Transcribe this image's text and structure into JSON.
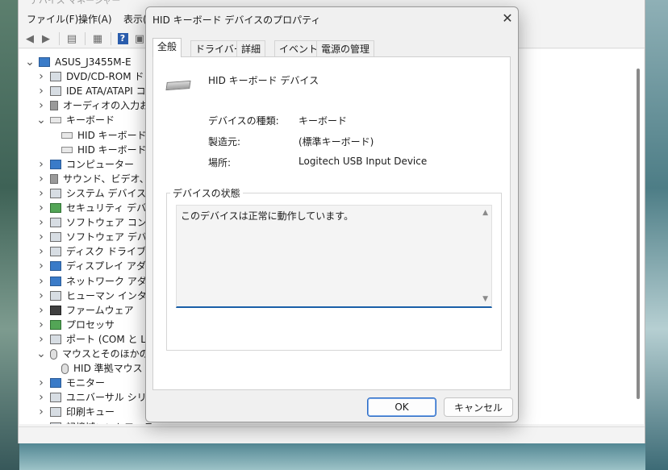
{
  "main_window": {
    "title": "デバイス マネージャー",
    "menu": [
      "ファイル(F)",
      "操作(A)",
      "表示("
    ],
    "tree": [
      {
        "label": "ASUS_J3455M-E",
        "level": 0,
        "expander": "v",
        "icon": "computer-icon"
      },
      {
        "label": "DVD/CD-ROM ドラ",
        "level": 1,
        "expander": ">",
        "icon": "dvd-drive-icon"
      },
      {
        "label": "IDE ATA/ATAPI コン",
        "level": 1,
        "expander": ">",
        "icon": "ide-controller-icon"
      },
      {
        "label": "オーディオの入力およ",
        "level": 1,
        "expander": ">",
        "icon": "audio-input-icon"
      },
      {
        "label": "キーボード",
        "level": 1,
        "expander": "v",
        "icon": "keyboard-icon"
      },
      {
        "label": "HID キーボード デ",
        "level": 2,
        "expander": "",
        "icon": "keyboard-icon"
      },
      {
        "label": "HID キーボード デ",
        "level": 2,
        "expander": "",
        "icon": "keyboard-icon"
      },
      {
        "label": "コンピューター",
        "level": 1,
        "expander": ">",
        "icon": "monitor-icon"
      },
      {
        "label": "サウンド、ビデオ、およ",
        "level": 1,
        "expander": ">",
        "icon": "speaker-icon"
      },
      {
        "label": "システム デバイス",
        "level": 1,
        "expander": ">",
        "icon": "system-device-icon"
      },
      {
        "label": "セキュリティ デバイス",
        "level": 1,
        "expander": ">",
        "icon": "security-device-icon"
      },
      {
        "label": "ソフトウェア コンポーネ",
        "level": 1,
        "expander": ">",
        "icon": "software-component-icon"
      },
      {
        "label": "ソフトウェア デバイス",
        "level": 1,
        "expander": ">",
        "icon": "software-device-icon"
      },
      {
        "label": "ディスク ドライブ",
        "level": 1,
        "expander": ">",
        "icon": "disk-drive-icon"
      },
      {
        "label": "ディスプレイ アダプター",
        "level": 1,
        "expander": ">",
        "icon": "display-adapter-icon"
      },
      {
        "label": "ネットワーク アダプター",
        "level": 1,
        "expander": ">",
        "icon": "network-adapter-icon"
      },
      {
        "label": "ヒューマン インターフェ",
        "level": 1,
        "expander": ">",
        "icon": "hid-icon"
      },
      {
        "label": "ファームウェア",
        "level": 1,
        "expander": ">",
        "icon": "firmware-icon"
      },
      {
        "label": "プロセッサ",
        "level": 1,
        "expander": ">",
        "icon": "processor-icon"
      },
      {
        "label": "ポート (COM と LPT",
        "level": 1,
        "expander": ">",
        "icon": "port-icon"
      },
      {
        "label": "マウスとそのほかのポ",
        "level": 1,
        "expander": "v",
        "icon": "mouse-icon"
      },
      {
        "label": "HID 準拠マウス",
        "level": 2,
        "expander": "",
        "icon": "mouse-icon"
      },
      {
        "label": "モニター",
        "level": 1,
        "expander": ">",
        "icon": "monitor-icon"
      },
      {
        "label": "ユニバーサル シリアル",
        "level": 1,
        "expander": ">",
        "icon": "usb-icon"
      },
      {
        "label": "印刷キュー",
        "level": 1,
        "expander": ">",
        "icon": "printer-icon"
      },
      {
        "label": "記憶域コントローラー",
        "level": 1,
        "expander": ">",
        "icon": "storage-controller-icon"
      }
    ]
  },
  "dialog": {
    "title": "HID キーボード デバイスのプロパティ",
    "close_glyph": "✕",
    "tabs": [
      "全般",
      "ドライバー",
      "詳細",
      "イベント",
      "電源の管理"
    ],
    "active_tab": 0,
    "device_name": "HID キーボード デバイス",
    "properties": [
      {
        "label": "デバイスの種類:",
        "value": "キーボード"
      },
      {
        "label": "製造元:",
        "value": "(標準キーボード)"
      },
      {
        "label": "場所:",
        "value": "Logitech USB Input Device"
      }
    ],
    "status_group_title": "デバイスの状態",
    "status_text": "このデバイスは正常に動作しています。",
    "ok_label": "OK",
    "cancel_label": "キャンセル"
  },
  "colors": {
    "accent": "#1a5fa8",
    "dialog_bg": "#f0f0f0",
    "panel_bg": "#ffffff"
  }
}
